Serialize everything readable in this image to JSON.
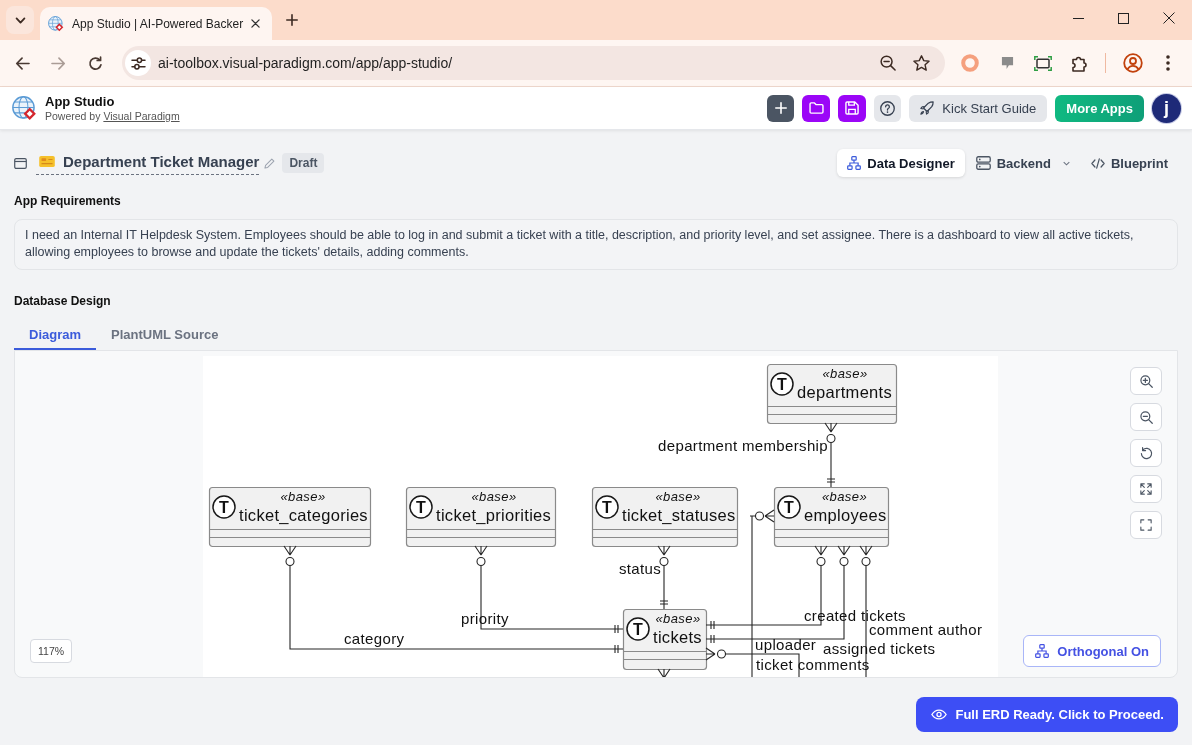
{
  "browser": {
    "tabs": [
      {
        "title": "App Studio | AI-Powered Backer",
        "selected": true
      }
    ],
    "url": "ai-toolbox.visual-paradigm.com/app/app-studio/"
  },
  "app_header": {
    "title": "App Studio",
    "powered_by": "Powered by",
    "powered_by_link": "Visual Paradigm",
    "kick_start_button": "Kick Start Guide",
    "more_apps_button": "More Apps",
    "avatar": "j"
  },
  "project": {
    "name": "Department Ticket Manager",
    "status": "Draft"
  },
  "views": [
    {
      "label": "Data Designer",
      "selected": true,
      "dropdown": false
    },
    {
      "label": "Backend",
      "selected": false,
      "dropdown": true
    },
    {
      "label": "Blueprint",
      "selected": false,
      "dropdown": false
    }
  ],
  "requirements": {
    "title": "App Requirements",
    "text": "I need an Internal IT Helpdesk System. Employees should be able to log in and submit a ticket with a title, description, and priority level, and set assignee. There is a dashboard to view all active tickets, allowing employees to browse and update the tickets' details, adding comments."
  },
  "database_design": {
    "title": "Database Design",
    "tabs": [
      {
        "label": "Diagram",
        "selected": true
      },
      {
        "label": "PlantUML Source",
        "selected": false
      }
    ],
    "diagram": {
      "entities": [
        {
          "spot": "T",
          "stereotype": "«base»",
          "name": "departments"
        },
        {
          "spot": "T",
          "stereotype": "«base»",
          "name": "ticket_categories"
        },
        {
          "spot": "T",
          "stereotype": "«base»",
          "name": "ticket_priorities"
        },
        {
          "spot": "T",
          "stereotype": "«base»",
          "name": "ticket_statuses"
        },
        {
          "spot": "T",
          "stereotype": "«base»",
          "name": "employees"
        },
        {
          "spot": "T",
          "stereotype": "«base»",
          "name": "tickets"
        }
      ],
      "relationships": [
        {
          "label": "department membership"
        },
        {
          "label": "status"
        },
        {
          "label": "created tickets"
        },
        {
          "label": "priority"
        },
        {
          "label": "comment author"
        },
        {
          "label": "category"
        },
        {
          "label": "uploader"
        },
        {
          "label": "assigned tickets"
        },
        {
          "label": "ticket comments"
        }
      ]
    },
    "zoom_level": "117%",
    "orthogonal_button": "Orthogonal On"
  },
  "proceed_button": "Full ERD Ready. Click to Proceed."
}
